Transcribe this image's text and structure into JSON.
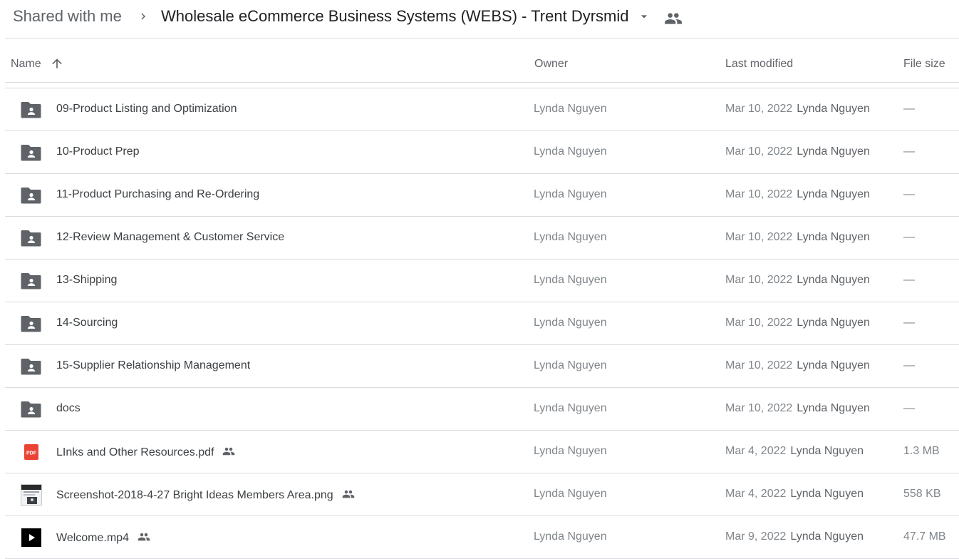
{
  "breadcrumb": {
    "root": "Shared with me",
    "current": "Wholesale eCommerce Business Systems (WEBS) - Trent Dyrsmid"
  },
  "columns": {
    "name": "Name",
    "owner": "Owner",
    "last_modified": "Last modified",
    "file_size": "File size"
  },
  "rows": [
    {
      "name": "09-Product Listing and Optimization",
      "type": "shared-folder",
      "owner": "Lynda Nguyen",
      "date": "Mar 10, 2022",
      "by": "Lynda Nguyen",
      "size": "—"
    },
    {
      "name": "10-Product Prep",
      "type": "shared-folder",
      "owner": "Lynda Nguyen",
      "date": "Mar 10, 2022",
      "by": "Lynda Nguyen",
      "size": "—"
    },
    {
      "name": "11-Product Purchasing and Re-Ordering",
      "type": "shared-folder",
      "owner": "Lynda Nguyen",
      "date": "Mar 10, 2022",
      "by": "Lynda Nguyen",
      "size": "—"
    },
    {
      "name": "12-Review Management & Customer Service",
      "type": "shared-folder",
      "owner": "Lynda Nguyen",
      "date": "Mar 10, 2022",
      "by": "Lynda Nguyen",
      "size": "—"
    },
    {
      "name": "13-Shipping",
      "type": "shared-folder",
      "owner": "Lynda Nguyen",
      "date": "Mar 10, 2022",
      "by": "Lynda Nguyen",
      "size": "—"
    },
    {
      "name": "14-Sourcing",
      "type": "shared-folder",
      "owner": "Lynda Nguyen",
      "date": "Mar 10, 2022",
      "by": "Lynda Nguyen",
      "size": "—"
    },
    {
      "name": "15-Supplier Relationship Management",
      "type": "shared-folder",
      "owner": "Lynda Nguyen",
      "date": "Mar 10, 2022",
      "by": "Lynda Nguyen",
      "size": "—"
    },
    {
      "name": "docs",
      "type": "shared-folder",
      "owner": "Lynda Nguyen",
      "date": "Mar 10, 2022",
      "by": "Lynda Nguyen",
      "size": "—"
    },
    {
      "name": "LInks and Other Resources.pdf",
      "type": "pdf",
      "shared": true,
      "owner": "Lynda Nguyen",
      "date": "Mar 4, 2022",
      "by": "Lynda Nguyen",
      "size": "1.3 MB",
      "icon_label": "PDF"
    },
    {
      "name": "Screenshot-2018-4-27 Bright Ideas Members Area.png",
      "type": "image",
      "shared": true,
      "owner": "Lynda Nguyen",
      "date": "Mar 4, 2022",
      "by": "Lynda Nguyen",
      "size": "558 KB"
    },
    {
      "name": "Welcome.mp4",
      "type": "video",
      "shared": true,
      "owner": "Lynda Nguyen",
      "date": "Mar 9, 2022",
      "by": "Lynda Nguyen",
      "size": "47.7 MB"
    }
  ],
  "colors": {
    "folder": "#5f6368",
    "pdf": "#ea4335",
    "divider": "#dadce0"
  }
}
